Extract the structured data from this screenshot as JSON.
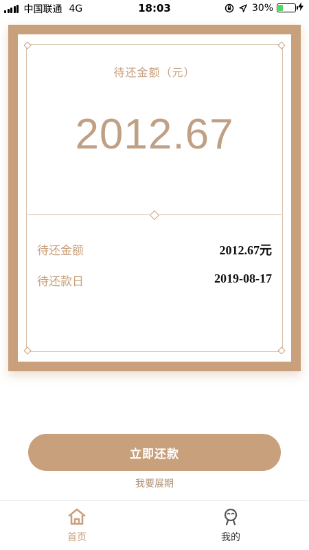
{
  "status_bar": {
    "carrier": "中国联通",
    "network": "4G",
    "time": "18:03",
    "battery": "30%",
    "battery_level": 0.3,
    "icons": [
      "signal-icon",
      "orientation-lock-icon",
      "location-icon",
      "battery-icon",
      "charging-icon"
    ]
  },
  "card": {
    "amount_title": "待还金额（元）",
    "amount": "2012.67",
    "rows": [
      {
        "label": "待还金额",
        "value": "2012.67元"
      },
      {
        "label": "待还款日",
        "value": "2019-08-17"
      }
    ]
  },
  "actions": {
    "repay_now": "立即还款",
    "extend": "我要展期"
  },
  "tabbar": {
    "items": [
      {
        "label": "首页",
        "icon": "home-icon",
        "active": true
      },
      {
        "label": "我的",
        "icon": "user-icon",
        "active": false
      }
    ]
  },
  "colors": {
    "accent": "#c9a07c",
    "active_tab": "#c9a07c",
    "inactive_tab": "#333333"
  }
}
